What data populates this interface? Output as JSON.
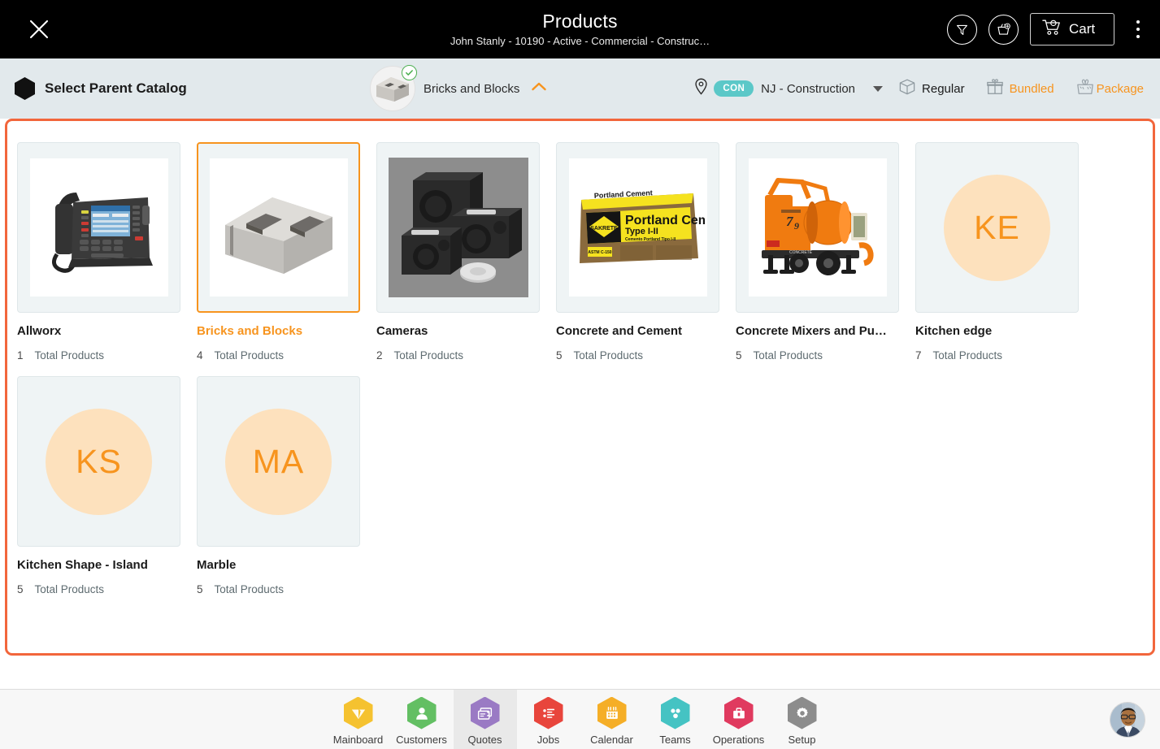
{
  "header": {
    "title": "Products",
    "subtitle": "John Stanly - 10190 - Active - Commercial - Construc…",
    "close_icon": "close-icon",
    "filter_icon": "filter-funnel-icon",
    "basket_icon": "add-to-basket-icon",
    "cart_label": "Cart",
    "cart_icon": "shopping-cart-icon",
    "overflow_icon": "kebab-menu-icon"
  },
  "toolbar": {
    "parent_catalog_label": "Select Parent Catalog",
    "parent_catalog_icon": "hexagon-icon",
    "selected_catalog": "Bricks and Blocks",
    "selected_catalog_thumb": "bricks-and-blocks-thumbnail",
    "selected_catalog_badge": "check-circle-icon",
    "collapse_icon": "chevron-up-icon",
    "location_icon": "location-pin-icon",
    "location_badge": "CON",
    "location_name": "NJ - Construction",
    "location_dropdown_icon": "chevron-down-icon",
    "modes": [
      {
        "label": "Regular",
        "icon": "box-package-icon",
        "active": true
      },
      {
        "label": "Bundled",
        "icon": "gift-box-icon",
        "active": false
      },
      {
        "label": "Package",
        "icon": "package-wrap-icon",
        "active": false
      }
    ]
  },
  "catalog_grid": {
    "total_products_label": "Total Products",
    "cards": [
      {
        "name": "Allworx",
        "count": "1",
        "thumb_type": "photo",
        "thumb_name": "allworx-desk-phone-photo",
        "selected": false
      },
      {
        "name": "Bricks and Blocks",
        "count": "4",
        "thumb_type": "photo",
        "thumb_name": "concrete-block-photo",
        "selected": true
      },
      {
        "name": "Cameras",
        "count": "2",
        "thumb_type": "photo",
        "thumb_name": "camera-speakers-photo",
        "selected": false
      },
      {
        "name": "Concrete and Cement",
        "count": "5",
        "thumb_type": "photo",
        "thumb_name": "portland-cement-bag-photo",
        "selected": false
      },
      {
        "name": "Concrete Mixers and Pu…",
        "count": "5",
        "thumb_type": "photo",
        "thumb_name": "concrete-mixer-pump-photo",
        "selected": false
      },
      {
        "name": "Kitchen edge",
        "count": "7",
        "thumb_type": "initials",
        "initials": "KE",
        "selected": false
      },
      {
        "name": "Kitchen Shape - Island",
        "count": "5",
        "thumb_type": "initials",
        "initials": "KS",
        "selected": false
      },
      {
        "name": "Marble",
        "count": "5",
        "thumb_type": "initials",
        "initials": "MA",
        "selected": false
      }
    ]
  },
  "bottom_nav": {
    "items": [
      {
        "label": "Mainboard",
        "icon": "mainboard-icon",
        "color": "#f5c230",
        "active": false
      },
      {
        "label": "Customers",
        "icon": "customers-person-icon",
        "color": "#63bf63",
        "active": false
      },
      {
        "label": "Quotes",
        "icon": "quotes-icon",
        "color": "#9a7ac4",
        "active": true
      },
      {
        "label": "Jobs",
        "icon": "jobs-list-icon",
        "color": "#e8453c",
        "active": false
      },
      {
        "label": "Calendar",
        "icon": "calendar-icon",
        "color": "#f5ae27",
        "active": false
      },
      {
        "label": "Teams",
        "icon": "teams-icon",
        "color": "#45c3c3",
        "active": false
      },
      {
        "label": "Operations",
        "icon": "operations-briefcase-icon",
        "color": "#e03a5f",
        "active": false
      },
      {
        "label": "Setup",
        "icon": "setup-gear-icon",
        "color": "#8c8c8c",
        "active": false
      }
    ],
    "avatar": "user-avatar"
  },
  "colors": {
    "accent_orange": "#f7941e",
    "frame_orange": "#f2663c",
    "header_bg": "#000000",
    "toolbar_bg": "#e2e9ec",
    "card_thumb_bg": "#eff4f5",
    "teal_pill": "#5bc8c8",
    "initials_bg": "#fde1bd"
  }
}
